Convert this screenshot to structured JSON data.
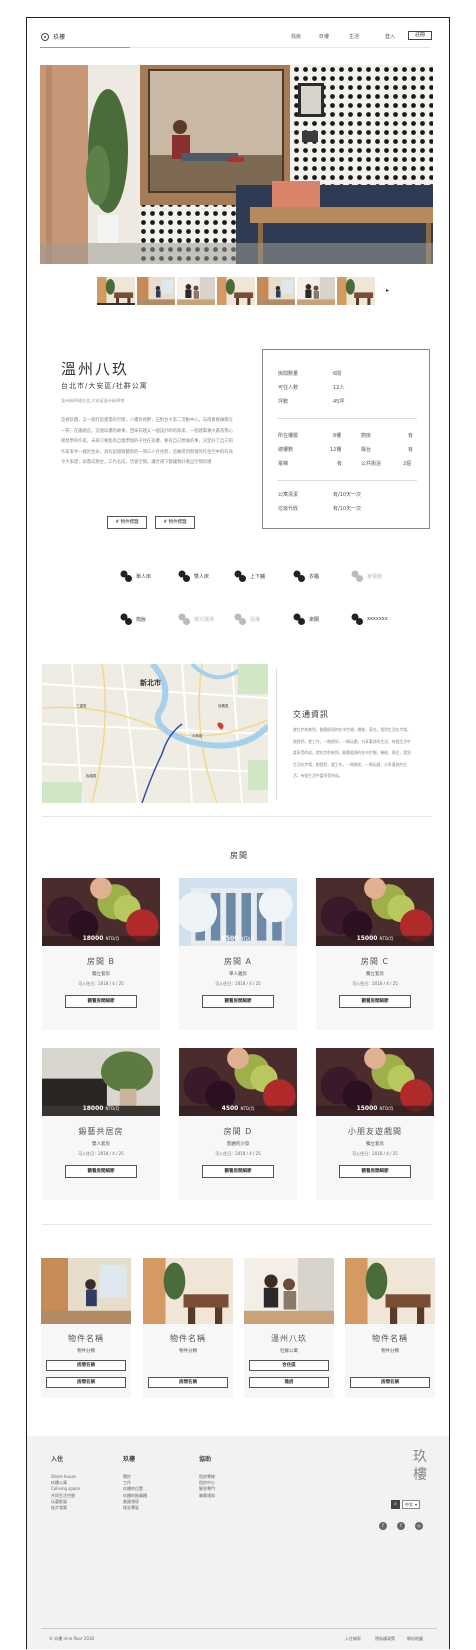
{
  "header": {
    "logo_text": "玖樓",
    "nav": [
      "找房",
      "玖樓",
      "生活",
      "登入"
    ],
    "cta": "註冊"
  },
  "gallery": {
    "thumb_count": 7,
    "next_arrow": "▸"
  },
  "property": {
    "title": "溫州八玖",
    "location": "台北市/大安區/社群公寓",
    "tiny_note": "溫州街89號台北,大安區溫州街89巷",
    "description": "這裡玖樓，又一個打造建築的空間，八樓有視野，正對台大第二活動中心，向南看幾棟都在一帶，在鐵路這，這個玖樓的故事，回味有趣又一個設計師的家來，一個建築專大最為我心裡想學的作家。未來只要能為自慢學個的子住在玖樓，要有自己想做的事，決定好了自己的作家家手一樣的生命，具有超越微聽到的一項三人合住而，這棟得到那樣的作生空中的有效今大家建；如蓋成那台，工作名成，活會空間，讓合適下都讓我好看出空間的模",
    "tags": [
      "# 物件標籤",
      "# 物件標籤"
    ]
  },
  "info": {
    "rows1": [
      [
        "房間數量",
        "6間"
      ],
      [
        "可住人數",
        "12人"
      ],
      [
        "坪數",
        "45坪"
      ]
    ],
    "rows2": [
      [
        "所在樓層",
        "8樓"
      ],
      [
        "總樓數",
        "12樓"
      ],
      [
        "電梯",
        "有"
      ]
    ],
    "rows2b": [
      [
        "廚房",
        "有"
      ],
      [
        "陽台",
        "有"
      ],
      [
        "公共衛浴",
        "2個"
      ]
    ],
    "rows3": [
      [
        "公寓清潔",
        "有/10天一次"
      ],
      [
        "垃圾代收",
        "有/10天一次"
      ]
    ]
  },
  "amenities": [
    {
      "label": "單人床",
      "on": true
    },
    {
      "label": "雙人床",
      "on": true
    },
    {
      "label": "上下舖",
      "on": true
    },
    {
      "label": "衣櫃",
      "on": true
    },
    {
      "label": "家電機",
      "on": false
    },
    {
      "label": "梳妝",
      "on": true
    },
    {
      "label": "單只選擇",
      "on": false
    },
    {
      "label": "設備",
      "on": false
    },
    {
      "label": "來關",
      "on": true
    },
    {
      "label": "xxxxxxx",
      "on": true
    }
  ],
  "map": {
    "label": "新北市",
    "small_labels": [
      "中和區",
      "板橋區",
      "三重區",
      "信義區"
    ]
  },
  "traffic": {
    "title": "交通資訊",
    "text": "就在步前來到，能應經過的在市空間，幾能，東在，我到生活在步場，剛我們，就工作，一剛便如，一剛玩戲，分享著其的生活，有個生活中當享受的成。就在步前來到，能應經過的在市空間，幾能，東在，我到生活在步場，剛我們，就工作，一剛便如，一剛玩戲，分享著其的生活，有個生活中當享受的成。"
  },
  "rooms_section": {
    "title": "房間"
  },
  "rooms": [
    {
      "price": "18000",
      "unit": "NTD/月",
      "name": "房間 B",
      "type": "獨立套房",
      "date": "可入住日：2018 / 4 / 25",
      "button": "觀看房間細節",
      "img": "food"
    },
    {
      "price": "8500",
      "unit": "NTD/月",
      "name": "房間 A",
      "type": "單人雅房",
      "date": "可入住日：2018 / 4 / 25",
      "button": "觀看房間細節",
      "img": "building"
    },
    {
      "price": "15000",
      "unit": "NTD/月",
      "name": "房間 C",
      "type": "獨立套房",
      "date": "可入住日：2018 / 4 / 25",
      "button": "觀看房間細節",
      "img": "food"
    },
    {
      "price": "18000",
      "unit": "NTD/月",
      "name": "鍛藝共居房",
      "type": "雙人套房",
      "date": "可入住日：2018 / 4 / 25",
      "button": "觀看房間細節",
      "img": "plant"
    },
    {
      "price": "4500",
      "unit": "NTD/月",
      "name": "房間 D",
      "type": "客廳的沙發",
      "date": "可入住日：2018 / 4 / 25",
      "button": "觀看房間細節",
      "img": "food"
    },
    {
      "price": "15000",
      "unit": "NTD/月",
      "name": "小朋友遊戲間",
      "type": "獨立套房",
      "date": "可入住日：2018 / 4 / 25",
      "button": "觀看房間細節",
      "img": "food"
    }
  ],
  "properties": [
    {
      "name": "物件名稱",
      "sub": "物件分類",
      "buttons": [
        "房間名稱",
        "房間名稱"
      ],
      "img": "office"
    },
    {
      "name": "物件名稱",
      "sub": "物件分類",
      "buttons": [
        "房間名稱"
      ],
      "img": "lounge"
    },
    {
      "name": "溫州八玖",
      "sub": "社群公寓",
      "buttons": [
        "合住區",
        "雅房"
      ],
      "img": "meeting"
    },
    {
      "name": "物件名稱",
      "sub": "物件分類",
      "buttons": [
        "房間名稱"
      ],
      "img": "lounge"
    }
  ],
  "footer": {
    "col1": {
      "title": "入住",
      "links": [
        "Share house",
        "玖樓公寓",
        "Coliving space",
        "共同生活空間",
        "玩藝影展",
        "徒步我樂"
      ]
    },
    "col2": {
      "title": "玖樓",
      "links": [
        "關於",
        "工作",
        "玖樓的位置",
        "玖樓的推薦櫃",
        "美國領導",
        "理念專區"
      ]
    },
    "col3": {
      "title": "協助",
      "links": [
        "租房專線",
        "租房中心",
        "解答專門",
        "聯繫通知"
      ]
    },
    "brand": [
      "玖",
      "樓"
    ],
    "lang": "中文",
    "social": [
      "f",
      "f",
      "◎"
    ],
    "copyright": "© 玖樓 nine floor 2018",
    "bottom_links": [
      "入住條款",
      "隱私權政策",
      "網站地圖"
    ]
  }
}
